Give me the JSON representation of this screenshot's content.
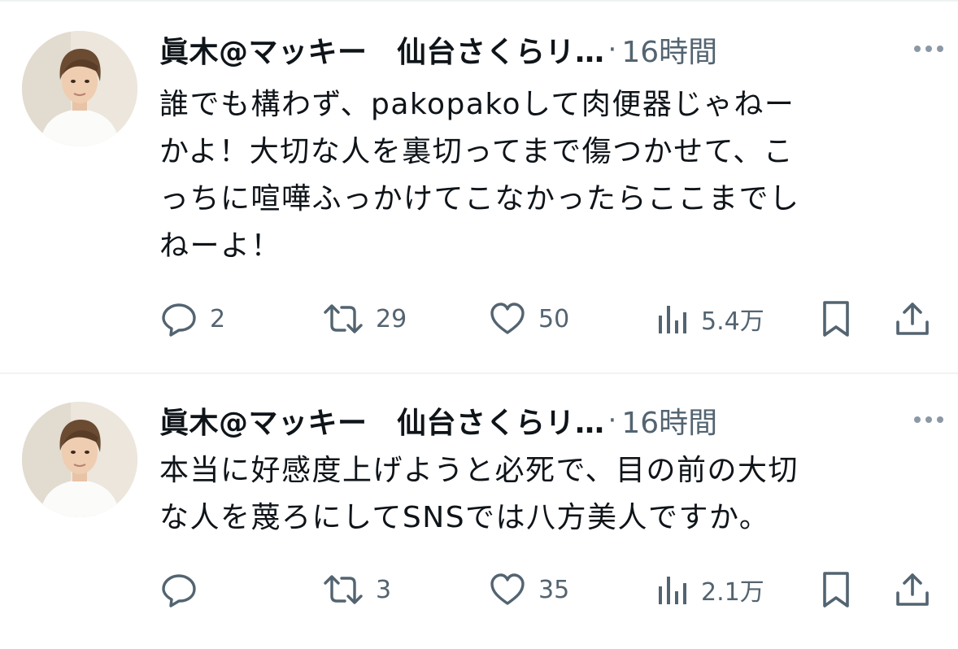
{
  "colors": {
    "text": "#0f1419",
    "secondary": "#536471",
    "divider": "#eff3f4"
  },
  "tweets": [
    {
      "author": "眞木@マッキー　仙台さくらリ…",
      "separator": "·",
      "time": "16時間",
      "text_lines": [
        "誰でも構わず、pakopakoして肉便器じゃねー",
        "かよ！大切な人を裏切ってまで傷つかせて、こ",
        "っちに喧嘩ふっかけてこなかったらここまでし",
        "ねーよ！"
      ],
      "replies": "2",
      "retweets": "29",
      "likes": "50",
      "views": "5.4万"
    },
    {
      "author": "眞木@マッキー　仙台さくらリ…",
      "separator": "·",
      "time": "16時間",
      "text_lines": [
        "本当に好感度上げようと必死で、目の前の大切",
        "な人を蔑ろにしてSNSでは八方美人ですか。"
      ],
      "replies": "",
      "retweets": "3",
      "likes": "35",
      "views": "2.1万"
    }
  ],
  "icons": {
    "reply": "speech-bubble-icon",
    "retweet": "repost-arrows-icon",
    "like": "heart-icon",
    "views": "bar-chart-icon",
    "bookmark": "bookmark-icon",
    "share": "share-upload-icon",
    "more": "three-dots-icon"
  }
}
